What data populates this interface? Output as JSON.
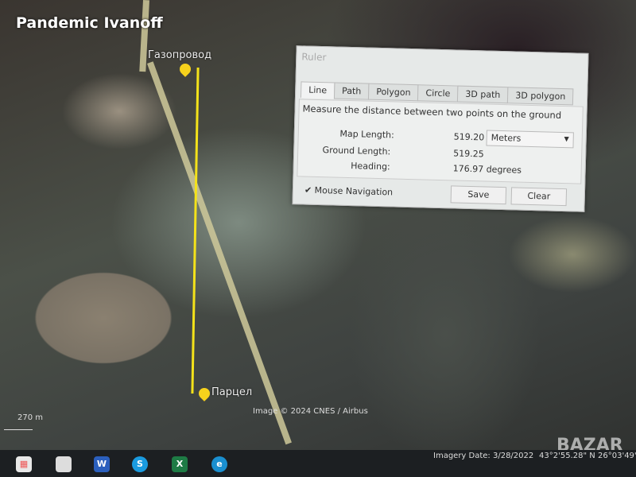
{
  "overlay_title": "Pandemic Ivanoff",
  "map": {
    "placemarks": [
      {
        "label": "Газопровод"
      },
      {
        "label": "Парцел"
      }
    ],
    "credit": "Image © 2024 CNES / Airbus",
    "scale": "270 m",
    "ruler_color": "#f4e21a"
  },
  "ruler": {
    "title": "Ruler",
    "tabs": [
      {
        "label": "Line",
        "active": true
      },
      {
        "label": "Path"
      },
      {
        "label": "Polygon"
      },
      {
        "label": "Circle"
      },
      {
        "label": "3D path"
      },
      {
        "label": "3D polygon"
      }
    ],
    "description": "Measure the distance between two points on the ground",
    "map_length_label": "Map Length:",
    "map_length": "519.20",
    "unit": "Meters",
    "ground_length_label": "Ground Length:",
    "ground_length": "519.25",
    "heading_label": "Heading:",
    "heading": "176.97 degrees",
    "mouse_navigation_label": "Mouse Navigation",
    "mouse_navigation_checked": true,
    "save_label": "Save",
    "clear_label": "Clear"
  },
  "status": {
    "imagery_date": "Imagery Date: 3/28/2022",
    "lat": "43°2'55.28\" N",
    "lon": "26°03'49\""
  },
  "taskbar": {
    "icons": [
      "store-icon",
      "file-icon",
      "word-icon",
      "skype-icon",
      "excel-icon",
      "edge-icon"
    ]
  },
  "watermark": "BAZAR"
}
